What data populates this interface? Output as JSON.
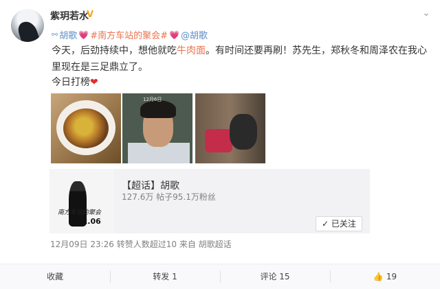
{
  "post": {
    "username": "紫玥若水",
    "vip_icon": "v-badge-icon",
    "tags": {
      "tag1": "胡歌",
      "tag2": "#南方车站的聚会#",
      "mention": "@胡歌"
    },
    "text": {
      "part1": "今天，后劲持续中，想他就吃",
      "highlight": "牛肉面",
      "part2": "。有时间还要再刷！苏先生，郑秋冬和周泽农在我心里现在是三足鼎立了。",
      "line2": "今日打榜"
    },
    "photos": [
      "photo-beef-noodles",
      "photo-man-eating",
      "photo-film-scene"
    ],
    "photo2_sign": "12月6日",
    "topic_card": {
      "title": "【超话】胡歌",
      "stats": "127.6万 帖子95.1万粉丝",
      "thumb_date": "12.06",
      "thumb_script": "南方车站的聚会",
      "follow_label": "已关注"
    },
    "meta": "12月09日 23:26 转赞人数超过10 来自 胡歌超话"
  },
  "actions": {
    "favorite": "收藏",
    "repost": "转发 1",
    "comment": "评论 15",
    "like": "19"
  },
  "colors": {
    "accent": "#eb7350",
    "link": "#5c8dc7",
    "vip": "#f5a623"
  }
}
